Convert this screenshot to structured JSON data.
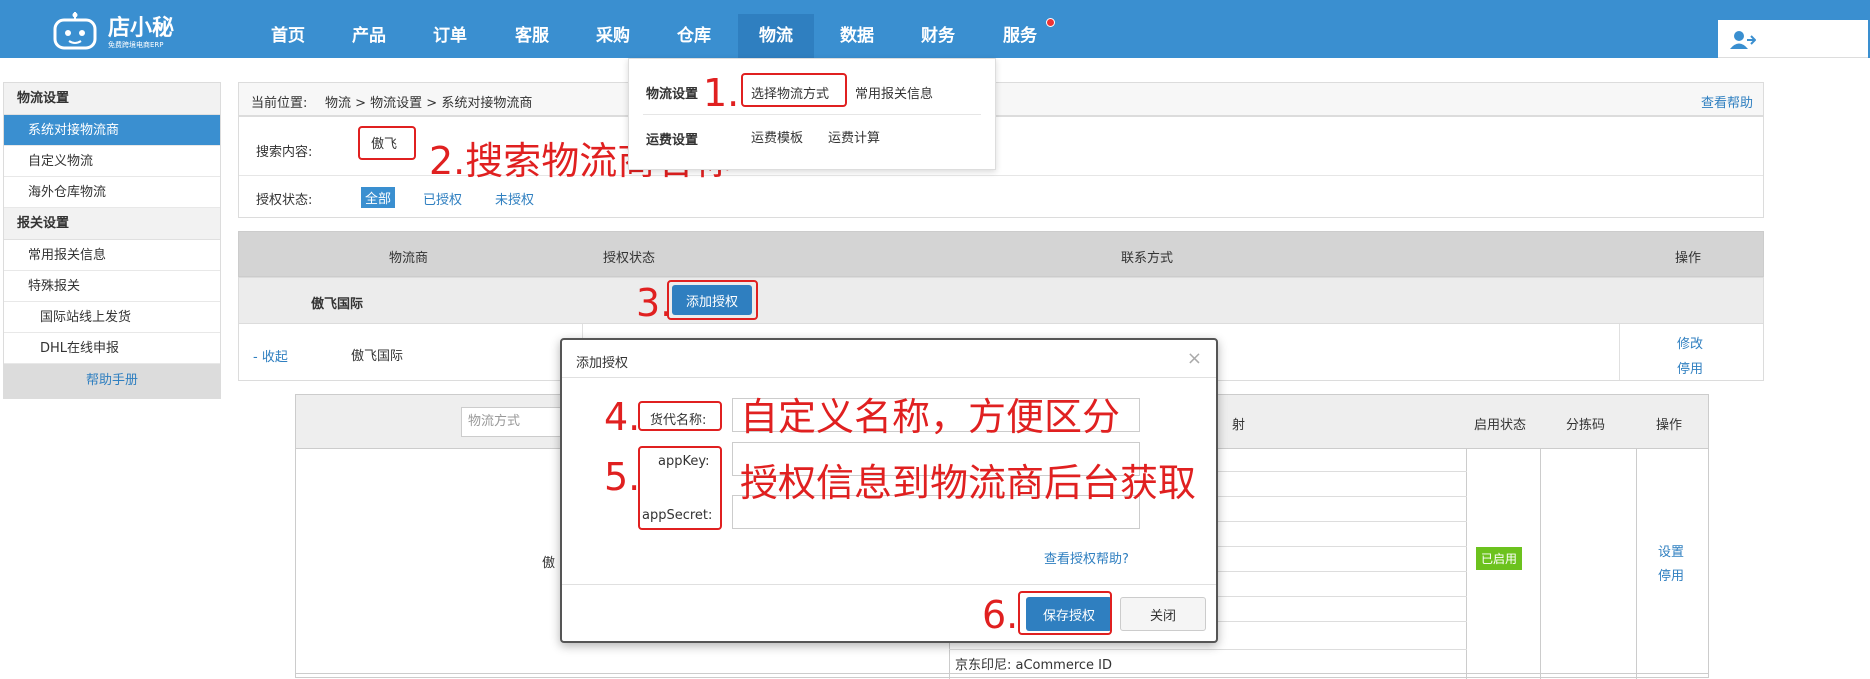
{
  "brand": {
    "name": "店小秘",
    "sub": "免费跨境电商ERP"
  },
  "nav": {
    "items": [
      {
        "label": "首页"
      },
      {
        "label": "产品"
      },
      {
        "label": "订单"
      },
      {
        "label": "客服"
      },
      {
        "label": "采购"
      },
      {
        "label": "仓库"
      },
      {
        "label": "物流"
      },
      {
        "label": "数据"
      },
      {
        "label": "财务"
      },
      {
        "label": "服务"
      }
    ],
    "active": "物流"
  },
  "sidebar": {
    "group1": "物流设置",
    "items1": [
      "系统对接物流商",
      "自定义物流",
      "海外仓库物流"
    ],
    "group2": "报关设置",
    "items2": [
      "常用报关信息",
      "特殊报关"
    ],
    "sub_items": [
      "国际站线上发货",
      "DHL在线申报"
    ],
    "help": "帮助手册"
  },
  "breadcrumb": {
    "prefix": "当前位置:",
    "path": "物流 > 物流设置 > 系统对接物流商",
    "help_link": "查看帮助"
  },
  "search": {
    "label": "搜索内容:",
    "value": "傲飞",
    "auth_label": "授权状态:",
    "filters": [
      "全部",
      "已授权",
      "未授权"
    ]
  },
  "dropdown": {
    "row1_title": "物流设置",
    "row1_links": [
      "选择物流方式",
      "常用报关信息"
    ],
    "row2_title": "运费设置",
    "row2_links": [
      "运费模板",
      "运费计算"
    ]
  },
  "table": {
    "headers": [
      "物流商",
      "授权状态",
      "联系方式",
      "操作"
    ],
    "carrier": "傲飞国际",
    "add_auth_button": "添加授权",
    "collapse_link": "- 收起",
    "row_carrier": "傲飞国际",
    "row_actions": [
      "修改",
      "停用"
    ]
  },
  "inner_table": {
    "method_placeholder": "物流方式",
    "headers": [
      "射",
      "启用状态",
      "分拣码",
      "操作"
    ],
    "partial_name": "傲",
    "status_badge": "已启用",
    "actions": [
      "设置",
      "停用"
    ],
    "mapping_row": "京东印尼:  aCommerce ID"
  },
  "modal": {
    "title": "添加授权",
    "close": "×",
    "fields": [
      {
        "label": "货代名称:",
        "value": ""
      },
      {
        "label": "appKey:",
        "value": ""
      },
      {
        "label": "appSecret:",
        "value": ""
      }
    ],
    "help_link": "查看授权帮助?",
    "save_button": "保存授权",
    "close_button": "关闭"
  },
  "annotations": {
    "a1": "1.",
    "a2": "2.搜索物流商名称",
    "a3": "3.",
    "a4": "4.",
    "a4_text": "自定义名称，方便区分",
    "a5": "5.",
    "a5_text": "授权信息到物流商后台获取",
    "a6": "6."
  },
  "colors": {
    "nav_bg": "#3a8fd0",
    "accent": "#2f7fc0",
    "annotation": "#e02020",
    "badge": "#6cc21e"
  }
}
